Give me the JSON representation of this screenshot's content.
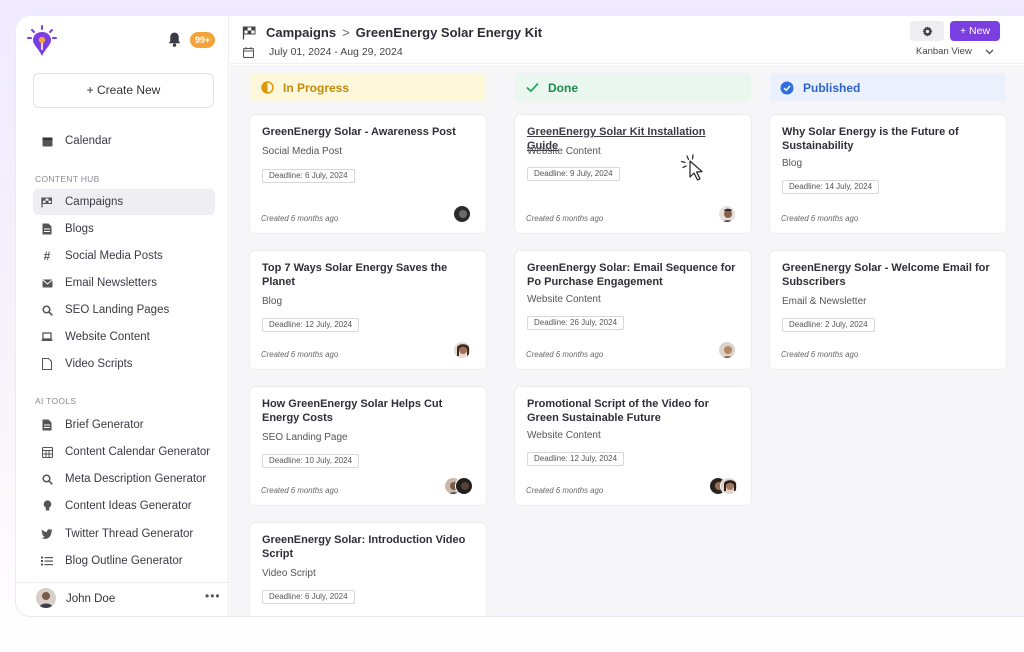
{
  "colors": {
    "accent": "#7b3ee0",
    "badge": "#f2a33a",
    "in_progress": "#d99a10",
    "done": "#22a35b",
    "published": "#2f6fe0"
  },
  "sidebar": {
    "notifications_badge": "99+",
    "create_new": "+ Create New",
    "calendar": "Calendar",
    "content_hub_label": "CONTENT HUB",
    "content_hub": [
      "Campaigns",
      "Blogs",
      "Social Media Posts",
      "Email Newsletters",
      "SEO Landing Pages",
      "Website Content",
      "Video Scripts"
    ],
    "ai_tools_label": "AI TOOLS",
    "ai_tools": [
      "Brief Generator",
      "Content Calendar Generator",
      "Meta Description Generator",
      "Content Ideas Generator",
      "Twitter Thread Generator",
      "Blog Outline Generator"
    ],
    "user_name": "John Doe",
    "more": "•••"
  },
  "header": {
    "crumb_parent": "Campaigns",
    "crumb_sep": ">",
    "crumb_current": "GreenEnergy Solar Energy Kit",
    "date_range": "July 01, 2024 - Aug 29, 2024",
    "new_button": "+ New",
    "view_select": "Kanban View"
  },
  "columns": [
    {
      "title": "In Progress",
      "icon": "half-circle-icon"
    },
    {
      "title": "Done",
      "icon": "check-icon"
    },
    {
      "title": "Published",
      "icon": "check-circle-icon"
    }
  ],
  "cards": {
    "c1": {
      "title": "GreenEnergy Solar - Awareness Post",
      "type": "Social Media Post",
      "deadline": "Deadline: 6 July, 2024",
      "created": "Created 6 months ago"
    },
    "c2": {
      "title": "Top 7 Ways Solar Energy Saves the Planet",
      "type": "Blog",
      "deadline": "Deadline: 12 July, 2024",
      "created": "Created 6 months ago"
    },
    "c3": {
      "title": "How GreenEnergy Solar Helps Cut Energy Costs",
      "type": "SEO Landing Page",
      "deadline": "Deadline: 10 July, 2024",
      "created": "Created 6 months ago"
    },
    "c4": {
      "title": "GreenEnergy Solar: Introduction Video Script",
      "type": "Video Script",
      "deadline": "Deadline: 6 July, 2024"
    },
    "d1": {
      "title": "GreenEnergy Solar Kit Installation Guide",
      "type": "Website Content",
      "deadline": "Deadline: 9 July, 2024",
      "created": "Created 6 months ago"
    },
    "d2": {
      "title": "GreenEnergy Solar: Email Sequence for Po Purchase Engagement",
      "type": "Website Content",
      "deadline": "Deadline: 26 July, 2024",
      "created": "Created 6 months ago"
    },
    "d3": {
      "title": "Promotional Script of the Video for Green Sustainable Future",
      "type": "Website Content",
      "deadline": "Deadline: 12 July, 2024",
      "created": "Created 6 months ago"
    },
    "p1": {
      "title": "Why Solar Energy is the Future of Sustainability",
      "type": "Blog",
      "deadline": "Deadline: 14 July, 2024",
      "created": "Created 6 months ago"
    },
    "p2": {
      "title": "GreenEnergy Solar - Welcome Email for Subscribers",
      "type": "Email & Newsletter",
      "deadline": "Deadline: 2 July, 2024",
      "created": "Created 6 months ago"
    }
  }
}
